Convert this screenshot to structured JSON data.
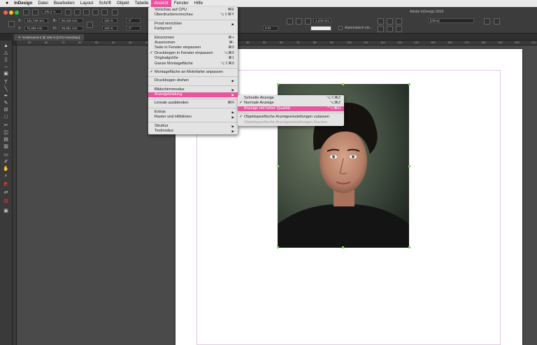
{
  "menubar": {
    "apple": "",
    "app": "InDesign",
    "items": [
      "Datei",
      "Bearbeiten",
      "Layout",
      "Schrift",
      "Objekt",
      "Tabelle",
      "Ansicht",
      "Fenster",
      "Hilfe"
    ],
    "active": "Ansicht"
  },
  "appbar": {
    "window_title": "Adobe InDesign 2019",
    "zoom": "105,3 %",
    "x": "181,749 mm",
    "y": "70,496 mm",
    "w": "80,349 mm",
    "h": "99,991 mm",
    "scale_x": "100 %",
    "scale_y": "100 %",
    "rotation": "0°",
    "shear": "0°",
    "stroke_weight": "0 Pt",
    "offset": "4,233 mm",
    "frame_style": "[Ohne]",
    "autofit_label": "Automatisch ein..."
  },
  "document_tab": {
    "label": "*Unbenannt-2 @ 105 % [CPU-Vorschau]"
  },
  "ruler": {
    "ticks": [
      "90",
      "80",
      "70",
      "60",
      "50",
      "40",
      "30",
      "20",
      "10",
      "0",
      "10",
      "20",
      "30",
      "40",
      "50",
      "60",
      "70",
      "80",
      "90",
      "100",
      "110",
      "120",
      "130",
      "140",
      "150",
      "160",
      "170",
      "180",
      "190",
      "200",
      "210",
      "220",
      "230"
    ]
  },
  "ansicht_menu": {
    "items": [
      {
        "label": "Vorschau auf CPU",
        "shortcut": "⌘E"
      },
      {
        "label": "Überdruckenvorschau",
        "shortcut": "⌥⇧⌘Y"
      },
      {
        "sep": true
      },
      {
        "label": "Proof einrichten",
        "arrow": "▶"
      },
      {
        "label": "Farbproof"
      },
      {
        "sep": true
      },
      {
        "label": "Einzoomen",
        "shortcut": "⌘+"
      },
      {
        "label": "Auszoomen",
        "shortcut": "⌘-"
      },
      {
        "label": "Seite in Fenster einpassen",
        "shortcut": "⌘0"
      },
      {
        "label": "Druckbogen in Fenster einpassen",
        "shortcut": "⌥⌘0",
        "check": "✓"
      },
      {
        "label": "Originalgröße",
        "shortcut": "⌘1"
      },
      {
        "label": "Ganze Montagefläche",
        "shortcut": "⌥⇧⌘0"
      },
      {
        "sep": true
      },
      {
        "label": "Montagefläche an Motivfarbe anpassen",
        "check": "✓"
      },
      {
        "sep": true
      },
      {
        "label": "Druckbogen drehen",
        "arrow": "▶"
      },
      {
        "sep": true
      },
      {
        "label": "Bildschirmmodus",
        "arrow": "▶"
      },
      {
        "label": "Anzeigeleistung",
        "arrow": "▶",
        "highlight": true
      },
      {
        "sep": true
      },
      {
        "label": "Lineale ausblenden",
        "shortcut": "⌘R"
      },
      {
        "sep": true
      },
      {
        "label": "Extras",
        "arrow": "▶"
      },
      {
        "label": "Raster und Hilfslinien",
        "arrow": "▶"
      },
      {
        "sep": true
      },
      {
        "label": "Struktur",
        "arrow": "▶"
      },
      {
        "label": "Textmodus",
        "arrow": "▶"
      }
    ]
  },
  "anzeige_submenu": {
    "items": [
      {
        "label": "Schnelle Anzeige",
        "shortcut": "⌥⇧⌘Z"
      },
      {
        "label": "Normale Anzeige",
        "shortcut": "⌥⌘Z",
        "check": "✓"
      },
      {
        "label": "Anzeige mit hoher Qualität",
        "shortcut": "^⌥⌘H",
        "highlight": true
      },
      {
        "sep": true
      },
      {
        "label": "Objektspezifische Anzeigeeinstellungen zulassen",
        "check": "✓"
      },
      {
        "label": "Objektspezifische Anzeigeeinstellungen löschen",
        "disabled": true
      }
    ]
  },
  "colors": {
    "menu_highlight": "#e8559e",
    "selection_handle": "#7fd44f"
  }
}
